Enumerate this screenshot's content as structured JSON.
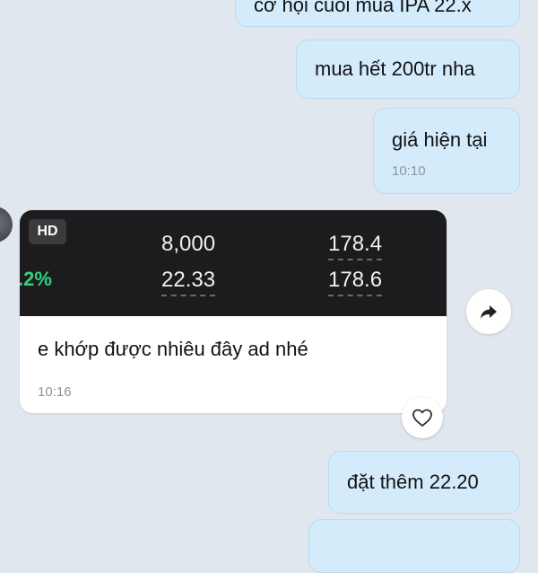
{
  "messages_out": [
    {
      "text": "cơ hội cuối mua IPA 22.x"
    },
    {
      "text": "mua hết 200tr nha"
    },
    {
      "text": "giá hiện tại",
      "time": "10:10"
    },
    {
      "text": "đặt thêm 22.20"
    },
    {
      "text": ""
    }
  ],
  "message_in": {
    "image": {
      "badge": "HD",
      "percent": ".2%",
      "values": [
        "8,000",
        "22.33",
        "178.4",
        "178.6"
      ]
    },
    "text": "e khớp được nhiêu đây ad nhé",
    "time": "10:16"
  },
  "icons": {
    "share": "share-arrow-icon",
    "react": "heart-outline-icon"
  },
  "colors": {
    "background": "#e1e7ef",
    "outgoing_bubble": "#d4ebfb",
    "incoming_bubble": "#ffffff",
    "percent_green": "#32d27a"
  }
}
